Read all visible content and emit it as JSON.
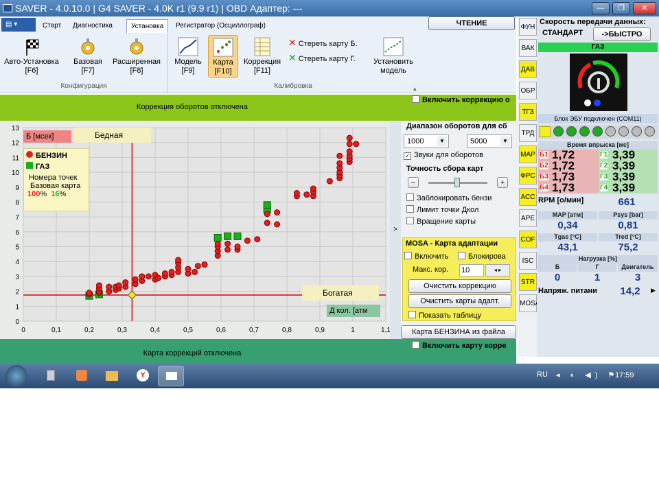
{
  "window": {
    "title": "SAVER - 4.0.10.0  |  G4 SAVER - 4.0K r1 (9.9 r1)  |  OBD Адаптер: ---"
  },
  "tabs": [
    "Старт",
    "Диагностика",
    "Установка",
    "Регистратор (Осциллограф)"
  ],
  "ribbon": {
    "config": [
      "Авто-Установка\n[F6]",
      "Базовая\n[F7]",
      "Расширенная\n[F8]"
    ],
    "config_group": "Конфигурация",
    "calib": [
      "Модель\n[F9]",
      "Карта\n[F10]",
      "Коррекция\n[F11]"
    ],
    "erase_b": "Стереть карту Б.",
    "erase_g": "Стереть карту Г.",
    "install_model": "Установить\nмодель",
    "calib_group": "Калибровка",
    "read": "ЧТЕНИЕ"
  },
  "topbar": {
    "text": "Коррекция оборотов отключена",
    "checkbox": "Включить коррекцию о"
  },
  "bottombar": {
    "text": "Карта коррекций отключена",
    "checkbox": "Включить карту корре"
  },
  "chart_labels": {
    "yunit": "Б [мсек]",
    "lean": "Бедная",
    "rich": "Богатая",
    "xunit": "Д кол. [атм"
  },
  "legend": {
    "benzin": "БЕНЗИН",
    "gaz": "ГАЗ",
    "points": "Номера точек",
    "base": "Базовая карта",
    "pct_benzin": "100",
    "pct_gaz": "16",
    "pct_sign": "%"
  },
  "chart_data": {
    "type": "scatter",
    "xlim": [
      0,
      1.1
    ],
    "ylim": [
      0,
      13
    ],
    "xticks": [
      "0",
      "0,1",
      "0,2",
      "0,3",
      "0,4",
      "0,5",
      "0,6",
      "0,7",
      "0,8",
      "0,9",
      "1",
      "1,1"
    ],
    "yticks": [
      "0",
      "1",
      "2",
      "3",
      "4",
      "5",
      "6",
      "7",
      "8",
      "9",
      "10",
      "11",
      "12",
      "13"
    ],
    "crosshair": {
      "x": 0.33,
      "y": 1.75
    },
    "series": [
      {
        "name": "БЕНЗИН",
        "color": "#e02020",
        "points": [
          [
            0.2,
            1.8
          ],
          [
            0.2,
            1.9
          ],
          [
            0.23,
            1.9
          ],
          [
            0.23,
            2.0
          ],
          [
            0.23,
            2.2
          ],
          [
            0.23,
            2.4
          ],
          [
            0.26,
            2.0
          ],
          [
            0.26,
            2.3
          ],
          [
            0.28,
            2.1
          ],
          [
            0.28,
            2.3
          ],
          [
            0.29,
            2.2
          ],
          [
            0.29,
            2.4
          ],
          [
            0.31,
            2.3
          ],
          [
            0.31,
            2.6
          ],
          [
            0.34,
            2.5
          ],
          [
            0.34,
            2.8
          ],
          [
            0.36,
            2.7
          ],
          [
            0.36,
            3.0
          ],
          [
            0.38,
            3.0
          ],
          [
            0.4,
            2.8
          ],
          [
            0.4,
            3.1
          ],
          [
            0.41,
            2.9
          ],
          [
            0.43,
            3.0
          ],
          [
            0.43,
            3.2
          ],
          [
            0.45,
            3.1
          ],
          [
            0.45,
            3.3
          ],
          [
            0.47,
            3.3
          ],
          [
            0.47,
            3.6
          ],
          [
            0.47,
            3.9
          ],
          [
            0.47,
            4.1
          ],
          [
            0.5,
            3.2
          ],
          [
            0.5,
            3.5
          ],
          [
            0.52,
            3.3
          ],
          [
            0.53,
            3.7
          ],
          [
            0.55,
            3.8
          ],
          [
            0.59,
            4.4
          ],
          [
            0.59,
            4.7
          ],
          [
            0.59,
            5.0
          ],
          [
            0.59,
            5.2
          ],
          [
            0.62,
            4.8
          ],
          [
            0.62,
            5.2
          ],
          [
            0.65,
            4.8
          ],
          [
            0.65,
            5.0
          ],
          [
            0.68,
            5.4
          ],
          [
            0.71,
            5.5
          ],
          [
            0.74,
            6.6
          ],
          [
            0.74,
            7.2
          ],
          [
            0.77,
            6.5
          ],
          [
            0.77,
            7.3
          ],
          [
            0.83,
            8.4
          ],
          [
            0.83,
            8.6
          ],
          [
            0.86,
            8.5
          ],
          [
            0.88,
            8.4
          ],
          [
            0.88,
            8.7
          ],
          [
            0.88,
            8.9
          ],
          [
            0.93,
            9.4
          ],
          [
            0.96,
            9.6
          ],
          [
            0.96,
            9.8
          ],
          [
            0.96,
            10.0
          ],
          [
            0.96,
            10.3
          ],
          [
            0.96,
            10.6
          ],
          [
            0.96,
            11.1
          ],
          [
            0.99,
            10.7
          ],
          [
            0.99,
            10.9
          ],
          [
            0.99,
            11.1
          ],
          [
            0.99,
            11.4
          ],
          [
            0.99,
            11.9
          ],
          [
            0.99,
            12.3
          ],
          [
            1.01,
            11.9
          ]
        ]
      },
      {
        "name": "ГАЗ",
        "color": "#1ab01a",
        "points": [
          [
            0.2,
            1.7
          ],
          [
            0.23,
            1.8
          ],
          [
            0.59,
            5.6
          ],
          [
            0.62,
            5.7
          ],
          [
            0.65,
            5.7
          ],
          [
            0.74,
            7.5
          ],
          [
            0.74,
            7.8
          ]
        ]
      }
    ]
  },
  "right": {
    "rpm_range": "Диапазон оборотов для сб",
    "rpm_from": "1000",
    "rpm_to": "5000",
    "sounds": "Звуки для оборотов",
    "accuracy": "Точность сбора карт",
    "opts": [
      "Заблокировать бензи",
      "Лимит точки Дкол",
      "Вращение карты"
    ],
    "mosa": "MOSA - Карта адаптации",
    "mosa_enable": "Включить",
    "mosa_block": "Блокирова",
    "max_cor": "Макс. кор.",
    "max_cor_val": "10",
    "clear_cor": "Очистить коррекцию",
    "clear_adapt": "Очистить карты адапт.",
    "show_table": "Показать таблицу",
    "load_map": "Карта БЕНЗИНА из файла"
  },
  "sidetabs": [
    "ФУН",
    "ВАК",
    "ДАВ",
    "ОБР",
    "ТГЗ",
    "ТРД",
    "MAP",
    "ФРС",
    "АСС",
    "APE",
    "COF",
    "ISC",
    "STR",
    "MOSA"
  ],
  "status": {
    "speed_label": "Скорость передачи данных:",
    "speed_std": "СТАНДАРТ",
    "speed_fast": "->БЫСТРО",
    "fuel": "ГАЗ",
    "ecu": "Блок ЭБУ подключен (COM11)",
    "inj_hdr": "Время впрыска [мс]",
    "b_labels": [
      "Б1",
      "Б2",
      "Б3",
      "Б4"
    ],
    "b_vals": [
      "1,72",
      "1,72",
      "1,73",
      "1,73"
    ],
    "g_labels": [
      "Г1",
      "Г2",
      "Г3",
      "Г4"
    ],
    "g_vals": [
      "3,39",
      "3,39",
      "3,39",
      "3,39"
    ],
    "rpm_label": "RPM [о/мин]",
    "rpm": "661",
    "map_label": "MAP [атм]",
    "map": "0,34",
    "psys_label": "Psys [bar]",
    "psys": "0,81",
    "tgas_label": "Tgas [°C]",
    "tgas": "43,1",
    "tred_label": "Tred [°C]",
    "tred": "75,2",
    "load_hdr": "Нагрузка [%]",
    "load_b": "Б",
    "load_g": "Г",
    "load_e": "Двигатель",
    "load_vals": [
      "0",
      "1",
      "3"
    ],
    "volt_label": "Напряж. питани",
    "volt": "14,2"
  },
  "taskbar": {
    "lang": "RU",
    "time": "17:59"
  }
}
